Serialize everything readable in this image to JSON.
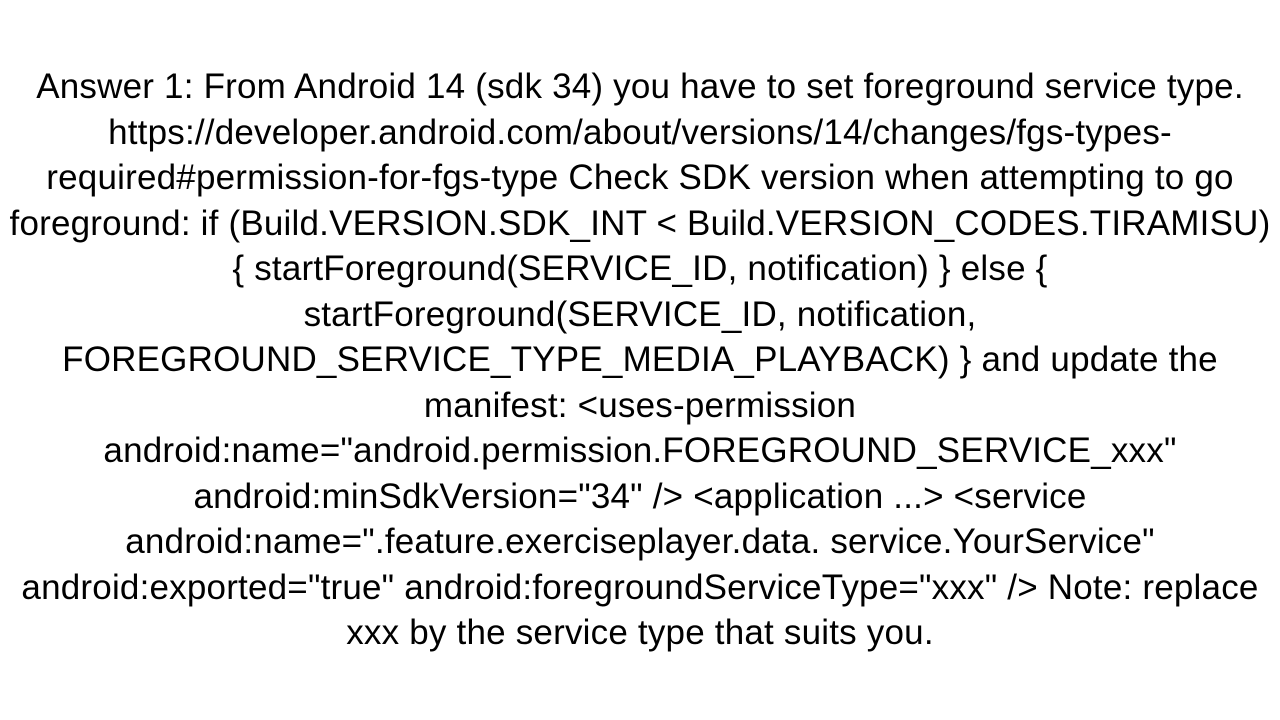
{
  "answer": {
    "text": "Answer 1: From Android 14 (sdk 34) you have to set foreground service type. https://developer.android.com/about/versions/14/changes/fgs-types-required#permission-for-fgs-type Check SDK version when attempting to go foreground: if (Build.VERSION.SDK_INT < Build.VERSION_CODES.TIRAMISU) { startForeground(SERVICE_ID, notification) } else { startForeground(SERVICE_ID, notification, FOREGROUND_SERVICE_TYPE_MEDIA_PLAYBACK) }  and update the manifest: <uses-permission android:name=\"android.permission.FOREGROUND_SERVICE_xxx\" android:minSdkVersion=\"34\" />    <application ...>     <service         android:name=\".feature.exerciseplayer.data. service.YourService\"           android:exported=\"true\"         android:foregroundServiceType=\"xxx\" />  Note: replace xxx by the service type that suits you."
  }
}
